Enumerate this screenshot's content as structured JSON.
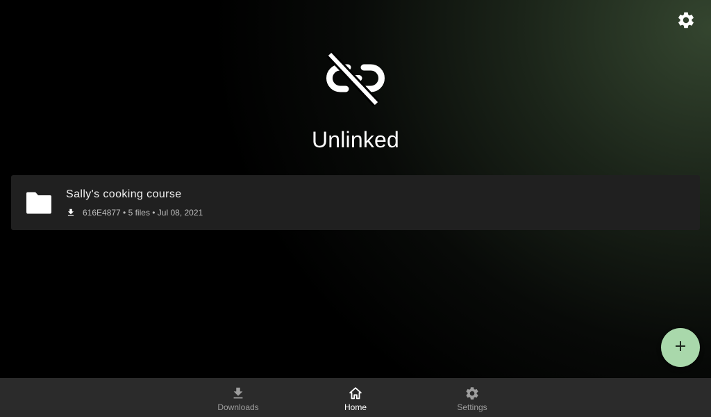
{
  "header": {
    "settings_icon": "gear-icon"
  },
  "status": {
    "icon": "link-off-icon",
    "title": "Unlinked"
  },
  "items": [
    {
      "icon": "folder-icon",
      "title": "Sally's cooking course",
      "meta_icon": "download-icon",
      "meta": "616E4877 • 5 files • Jul 08, 2021"
    }
  ],
  "fab": {
    "icon": "plus-icon",
    "color": "#a9d8ab"
  },
  "bottom_nav": {
    "items": [
      {
        "label": "Downloads",
        "icon": "download-icon",
        "active": false
      },
      {
        "label": "Home",
        "icon": "home-icon",
        "active": true
      },
      {
        "label": "Settings",
        "icon": "gear-icon",
        "active": false
      }
    ]
  },
  "colors": {
    "background": "#000000",
    "card": "#202020",
    "nav": "#2b2b2b",
    "accent": "#a9d8ab"
  }
}
